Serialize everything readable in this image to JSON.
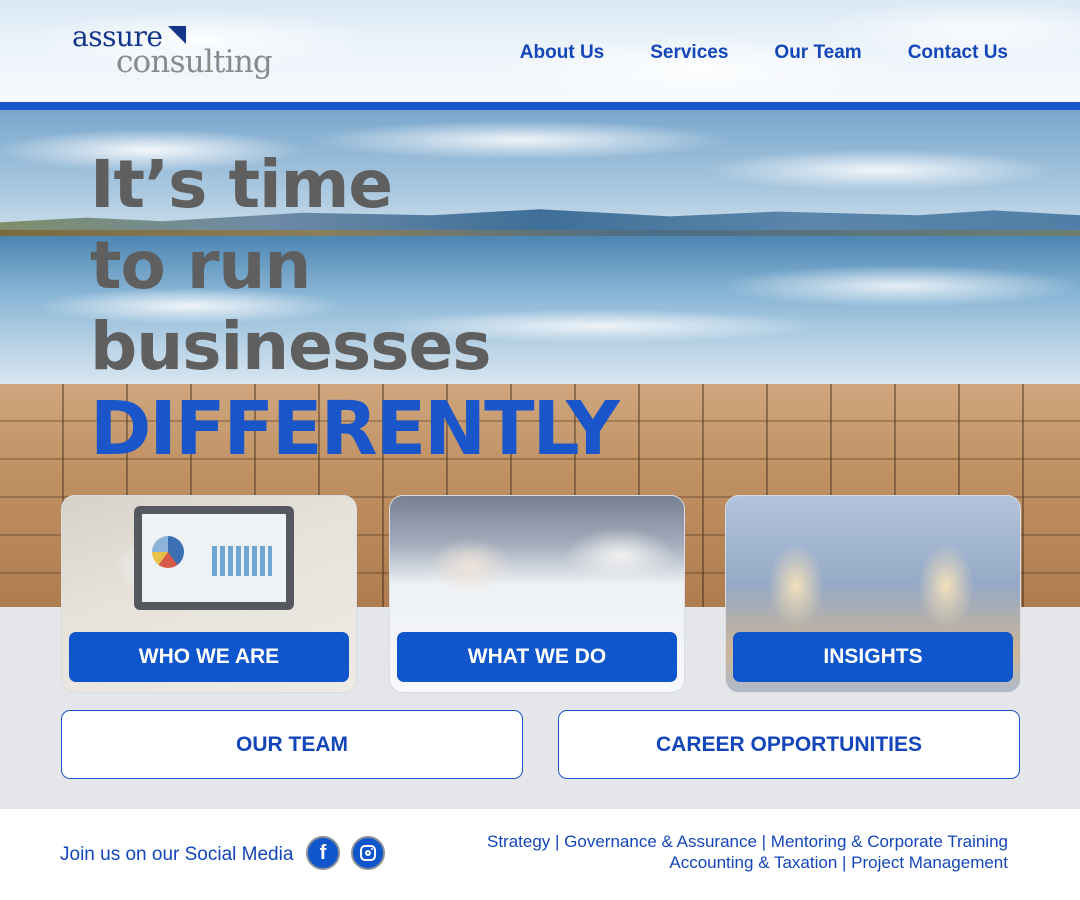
{
  "logo": {
    "line1": "assure",
    "line2": "consulting"
  },
  "nav": {
    "about": "About Us",
    "services": "Services",
    "team": "Our Team",
    "contact": "Contact Us"
  },
  "hero": {
    "line1": "It’s time",
    "line2": "to run",
    "line3": "businesses",
    "accent": "DIFFERENTLY"
  },
  "cards": [
    {
      "label": "WHO WE ARE"
    },
    {
      "label": "WHAT WE DO"
    },
    {
      "label": "INSIGHTS"
    }
  ],
  "buttons": {
    "team": "OUR TEAM",
    "careers": "CAREER OPPORTUNITIES"
  },
  "footer": {
    "social_label": "Join us on our Social Media",
    "facebook_glyph": "f",
    "links_line1": "Strategy | Governance & Assurance | Mentoring & Corporate Training",
    "links_line2": "Accounting & Taxation | Project Management"
  },
  "icons": {
    "facebook": "facebook-icon",
    "instagram": "instagram-icon"
  },
  "colors": {
    "brand_blue": "#1a56c9",
    "button_blue": "#0f55cc",
    "heading_gray": "#5f5f5f",
    "band_gray": "#e4e6e9"
  }
}
